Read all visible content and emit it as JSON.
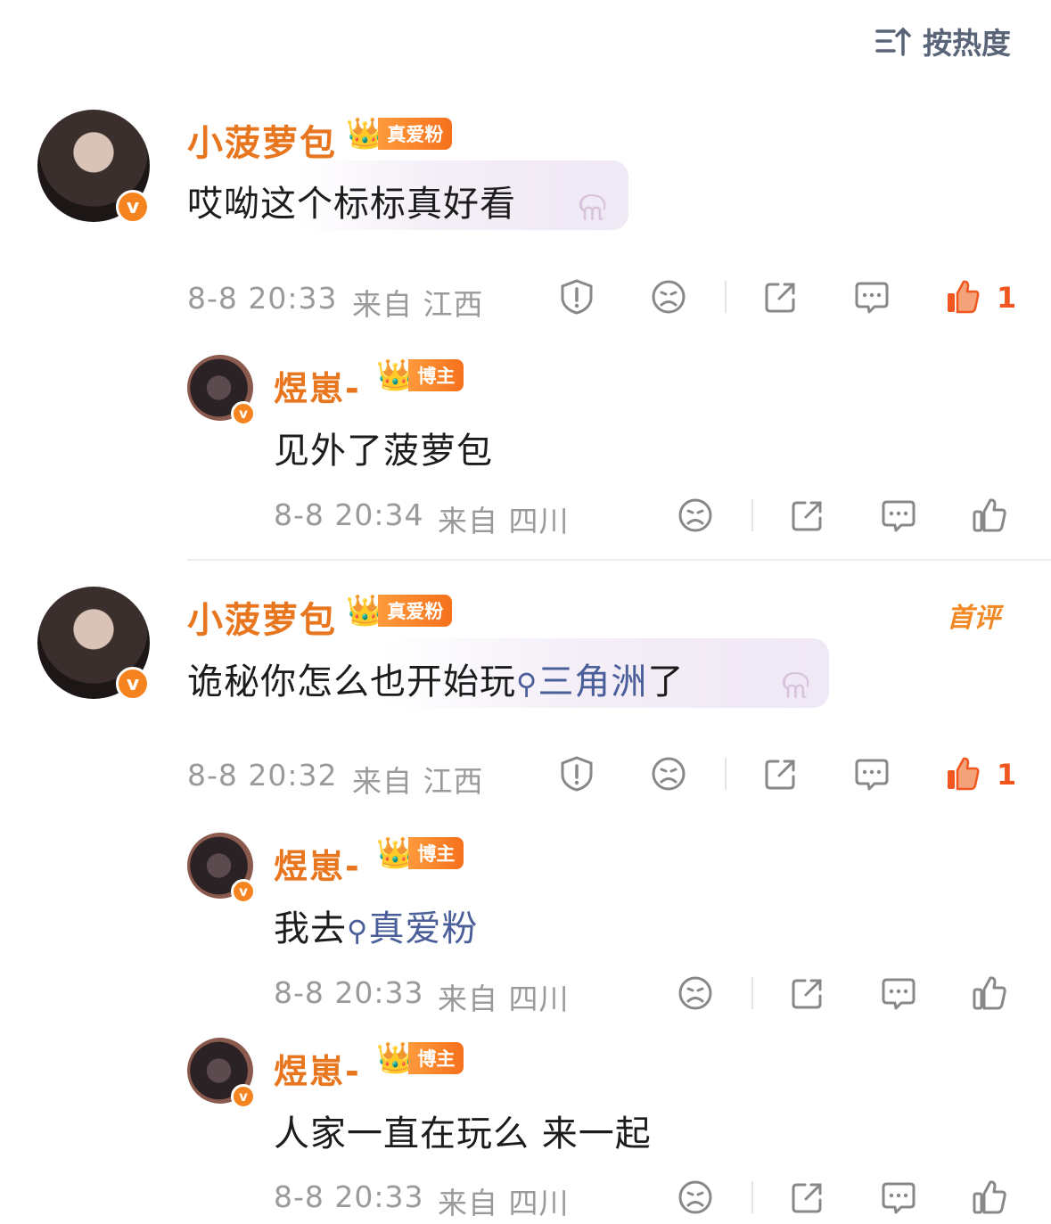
{
  "sort": {
    "label": "按热度"
  },
  "comments": [
    {
      "name": "小菠萝包",
      "tag": "真爱粉",
      "text": "哎呦这个标标真好看",
      "time": "8-8 20:33",
      "location": "来自 江西",
      "likes": "1",
      "replies": [
        {
          "name": "煜崽-",
          "tag": "博主",
          "text": "见外了菠萝包",
          "time": "8-8 20:34",
          "location": "来自 四川"
        }
      ]
    },
    {
      "name": "小菠萝包",
      "tag": "真爱粉",
      "first_badge": "首评",
      "text_prefix": "诡秘你怎么也开始玩",
      "link": "三角洲",
      "text_suffix": "了",
      "time": "8-8 20:32",
      "location": "来自 江西",
      "likes": "1",
      "replies": [
        {
          "name": "煜崽-",
          "tag": "博主",
          "text_prefix": "我去",
          "link": "真爱粉",
          "time": "8-8 20:33",
          "location": "来自 四川"
        },
        {
          "name": "煜崽-",
          "tag": "博主",
          "text": "人家一直在玩么 来一起",
          "time": "8-8 20:33",
          "location": "来自 四川"
        }
      ]
    }
  ],
  "icons": [
    "sort-icon",
    "report-icon",
    "dislike-icon",
    "share-icon",
    "comment-icon",
    "like-icon",
    "crown-icon",
    "search-icon",
    "verified-icon"
  ],
  "colors": {
    "name": "#e8761e",
    "like_active": "#f0561e",
    "link": "#4a5f9a",
    "meta": "#9a9a9a"
  }
}
